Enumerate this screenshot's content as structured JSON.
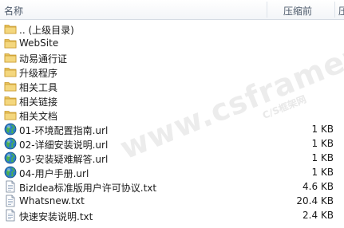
{
  "columns": {
    "name": "名称",
    "compressed_before": "压缩前",
    "more": "压"
  },
  "files": [
    {
      "icon": "folder-icon",
      "name": ".. (上级目录)",
      "size": ""
    },
    {
      "icon": "folder-icon",
      "name": "WebSite",
      "size": ""
    },
    {
      "icon": "folder-icon",
      "name": "动易通行证",
      "size": ""
    },
    {
      "icon": "folder-icon",
      "name": "升级程序",
      "size": ""
    },
    {
      "icon": "folder-icon",
      "name": "相关工具",
      "size": ""
    },
    {
      "icon": "folder-icon",
      "name": "相关链接",
      "size": ""
    },
    {
      "icon": "folder-icon",
      "name": "相关文档",
      "size": ""
    },
    {
      "icon": "internet-shortcut-icon",
      "name": "01-环境配置指南.url",
      "size": "1 KB"
    },
    {
      "icon": "internet-shortcut-icon",
      "name": "02-详细安装说明.url",
      "size": "1 KB"
    },
    {
      "icon": "internet-shortcut-icon",
      "name": "03-安装疑难解答.url",
      "size": "1 KB"
    },
    {
      "icon": "internet-shortcut-icon",
      "name": "04-用户手册.url",
      "size": "1 KB"
    },
    {
      "icon": "text-file-icon",
      "name": "BizIdea标准版用户许可协议.txt",
      "size": "4.6 KB"
    },
    {
      "icon": "text-file-icon",
      "name": "Whatsnew.txt",
      "size": "20.4 KB"
    },
    {
      "icon": "text-file-icon",
      "name": "快速安装说明.txt",
      "size": "2.4 KB"
    }
  ],
  "watermark": {
    "main": "www.csframework.com",
    "sub": "C/S框架网"
  }
}
